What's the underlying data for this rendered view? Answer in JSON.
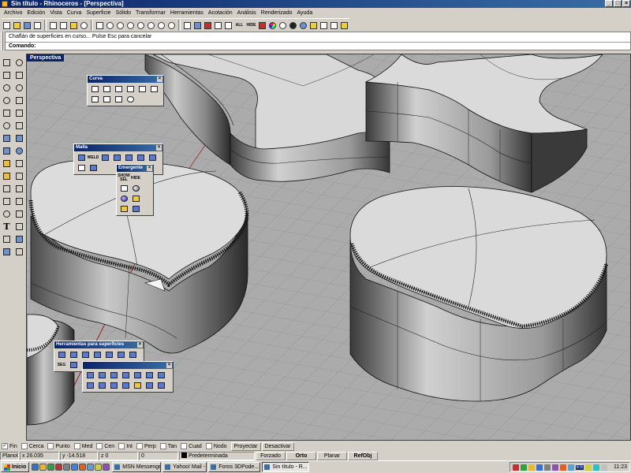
{
  "window": {
    "title": "Sin título - Rhinoceros - [Perspectiva]"
  },
  "menu": [
    "Archivo",
    "Edición",
    "Vista",
    "Curva",
    "Superficie",
    "Sólido",
    "Transformar",
    "Herramientas",
    "Acotación",
    "Análisis",
    "Renderizado",
    "Ayuda"
  ],
  "toolbar": {
    "all_label": "ALL",
    "hide_label": "HIDE"
  },
  "command": {
    "history": "Chaflán de superficies en curso... Pulse Esc para cancelar",
    "prompt": "Comando:"
  },
  "viewport": {
    "label": "Perspectiva"
  },
  "palettes": {
    "curva": {
      "title": "Curva"
    },
    "malla": {
      "title": "Malla",
      "weld_label": "WELD"
    },
    "emergente": {
      "title": "Emergente",
      "show_sel": "SHOW SEL",
      "hide": "HIDE"
    },
    "herramientas": {
      "title": "Herramientas para superficies",
      "seg_label": "SEG"
    }
  },
  "osnaps": [
    {
      "label": "Fin",
      "checked": true
    },
    {
      "label": "Cerca",
      "checked": false
    },
    {
      "label": "Punto",
      "checked": false
    },
    {
      "label": "Med",
      "checked": false
    },
    {
      "label": "Cen",
      "checked": false
    },
    {
      "label": "Int",
      "checked": false
    },
    {
      "label": "Perp",
      "checked": false
    },
    {
      "label": "Tan",
      "checked": false
    },
    {
      "label": "Cuad",
      "checked": false
    },
    {
      "label": "Nodo",
      "checked": false
    }
  ],
  "osnap_buttons": {
    "project": "Proyectar",
    "disable": "Desactivar"
  },
  "status": {
    "cplane": "PlanoC",
    "x": "x 26.035",
    "y": "y -14.518",
    "z": "z 0",
    "z_value": "0",
    "layer": "Predeterminada",
    "snap": "Forzado",
    "ortho": "Orto",
    "planar": "Planar",
    "osnap": "RefObj"
  },
  "taskbar": {
    "start": "Inicio",
    "tasks": [
      "MSN Messenger",
      "Yahoo! Mail - r...",
      "Foros 3DPode...",
      "Sin título - R..."
    ],
    "active_task": 3,
    "lang": "ES",
    "time": "11:23"
  }
}
